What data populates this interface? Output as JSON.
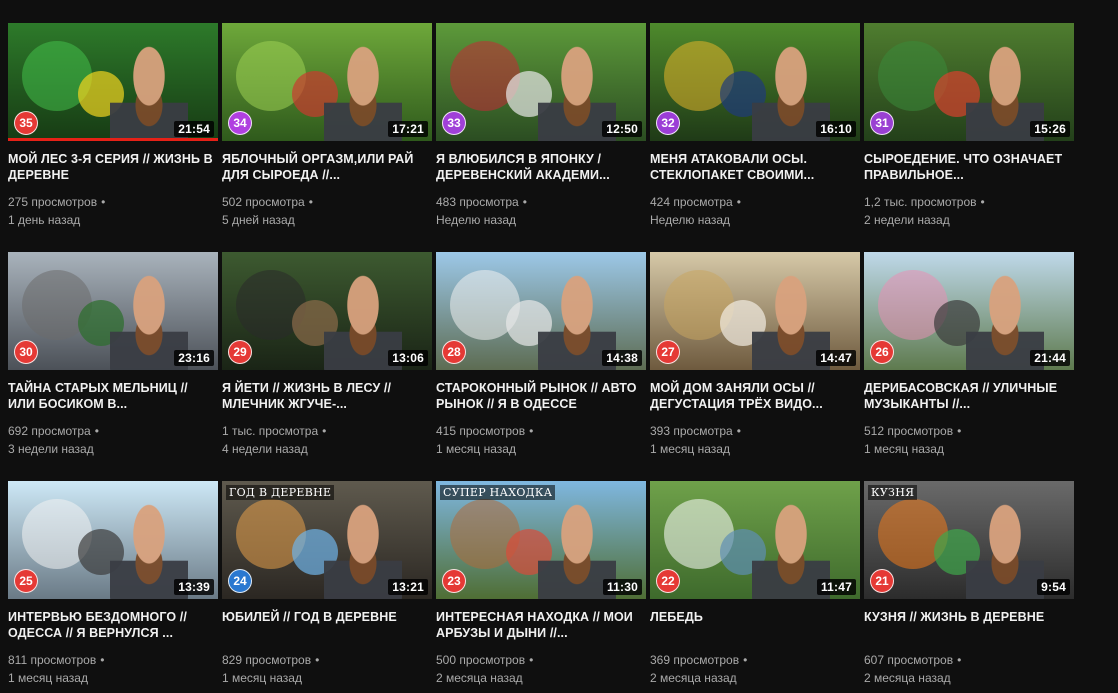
{
  "colors": {
    "background": "#0f0f0f",
    "title": "#f1f1f1",
    "meta": "#aaaaaa",
    "progress": "#e62117"
  },
  "videos": [
    {
      "title": "МОЙ ЛЕС 3-я СЕРИЯ // ЖИЗНЬ В ДЕРЕВНЕ",
      "views": "275 просмотров",
      "age": "1 день назад",
      "duration": "21:54",
      "badge": "35",
      "badge_color": "#e53935",
      "overlay": "",
      "watched": true,
      "thumb_top": "#2d7a2a",
      "thumb_bottom": "#173b14",
      "accent": "#43c04a",
      "blob": "#f2d41f"
    },
    {
      "title": "ЯБЛОЧНЫЙ ОРГАЗМ,ИЛИ РАЙ ДЛЯ СЫРОЕДА //...",
      "views": "502 просмотра",
      "age": "5 дней назад",
      "duration": "17:21",
      "badge": "34",
      "badge_color": "#b040e0",
      "overlay": "",
      "watched": false,
      "thumb_top": "#6ea83a",
      "thumb_bottom": "#2f5a1c",
      "accent": "#9fd154",
      "blob": "#c93a2f"
    },
    {
      "title": "Я ВЛЮБИЛСЯ В ЯПОНКУ / ДЕРЕВЕНСКИЙ АКАДЕМИ...",
      "views": "483 просмотра",
      "age": "Неделю назад",
      "duration": "12:50",
      "badge": "33",
      "badge_color": "#a040d8",
      "overlay": "",
      "watched": false,
      "thumb_top": "#5d9a3a",
      "thumb_bottom": "#2b4d22",
      "accent": "#c42a36",
      "blob": "#e8e8e8"
    },
    {
      "title": "МЕНЯ АТАКОВАЛИ ОСЫ. СТЕКЛОПАКЕТ СВОИМИ...",
      "views": "424 просмотра",
      "age": "Неделю назад",
      "duration": "16:10",
      "badge": "32",
      "badge_color": "#9b3ed6",
      "overlay": "",
      "watched": false,
      "thumb_top": "#4e8a2c",
      "thumb_bottom": "#1f3a17",
      "accent": "#e6b52a",
      "blob": "#1f3b7a"
    },
    {
      "title": "СЫРОЕДЕНИЕ. ЧТО ОЗНАЧАЕТ ПРАВИЛЬНОЕ...",
      "views": "1,2 тыс. просмотров",
      "age": "2 недели назад",
      "duration": "15:26",
      "badge": "31",
      "badge_color": "#9a40d2",
      "overlay": "",
      "watched": false,
      "thumb_top": "#4f7d2f",
      "thumb_bottom": "#23401a",
      "accent": "#3a8b3b",
      "blob": "#d9402e"
    },
    {
      "title": "ТАЙНА СТАРЫХ МЕЛЬНИЦ // ИЛИ БОСИКОМ В...",
      "views": "692 просмотра",
      "age": "3 недели назад",
      "duration": "23:16",
      "badge": "30",
      "badge_color": "#e53935",
      "overlay": "",
      "watched": false,
      "thumb_top": "#a9b3bc",
      "thumb_bottom": "#4c5158",
      "accent": "#6b6b6b",
      "blob": "#2b6d2b"
    },
    {
      "title": "Я ЙЕТИ // ЖИЗНЬ В ЛЕСУ // МЛЕЧНИК ЖГУЧЕ-...",
      "views": "1 тыс. просмотра",
      "age": "4 недели назад",
      "duration": "13:06",
      "badge": "29",
      "badge_color": "#e53935",
      "overlay": "",
      "watched": false,
      "thumb_top": "#3d5a30",
      "thumb_bottom": "#1a2416",
      "accent": "#2a2a2a",
      "blob": "#8c6b4a"
    },
    {
      "title": "СТАРОКОННЫЙ РЫНОК // АВТО РЫНОК // Я В ОДЕССЕ",
      "views": "415 просмотров",
      "age": "1 месяц назад",
      "duration": "14:38",
      "badge": "28",
      "badge_color": "#e53935",
      "overlay": "",
      "watched": false,
      "thumb_top": "#9cc8e8",
      "thumb_bottom": "#5d6c52",
      "accent": "#f0f0f0",
      "blob": "#e8e8e8"
    },
    {
      "title": "МОЙ ДОМ ЗАНЯЛИ ОСЫ // ДЕГУСТАЦИЯ ТРЁХ ВИДО...",
      "views": "393 просмотра",
      "age": "1 месяц назад",
      "duration": "14:47",
      "badge": "27",
      "badge_color": "#e53935",
      "overlay": "",
      "watched": false,
      "thumb_top": "#d6c9a8",
      "thumb_bottom": "#6e5a3e",
      "accent": "#c8a560",
      "blob": "#f2ede2"
    },
    {
      "title": "ДЕРИБАСОВСКАЯ // УЛИЧНЫЕ МУЗЫКАНТЫ //...",
      "views": "512 просмотров",
      "age": "1 месяц назад",
      "duration": "21:44",
      "badge": "26",
      "badge_color": "#e53935",
      "overlay": "",
      "watched": false,
      "thumb_top": "#bfd9ea",
      "thumb_bottom": "#5e7a4e",
      "accent": "#e88fb4",
      "blob": "#3a3a3a"
    },
    {
      "title": "ИНТЕРВЬЮ БЕЗДОМНОГО // ОДЕССА // Я ВЕРНУЛСЯ ...",
      "views": "811 просмотров",
      "age": "1 месяц назад",
      "duration": "13:39",
      "badge": "25",
      "badge_color": "#e53935",
      "overlay": "",
      "watched": false,
      "thumb_top": "#cde8f6",
      "thumb_bottom": "#6a7a86",
      "accent": "#f2f2f2",
      "blob": "#3c3c3c"
    },
    {
      "title": "ЮБИЛЕЙ // ГОД В ДЕРЕВНЕ",
      "views": "829 просмотров",
      "age": "1 месяц назад",
      "duration": "13:21",
      "badge": "24",
      "badge_color": "#2a78d0",
      "overlay": "ГОД В ДЕРЕВНЕ",
      "watched": false,
      "thumb_top": "#5f5a4e",
      "thumb_bottom": "#2b2722",
      "accent": "#e7a04a",
      "blob": "#6fb3e8"
    },
    {
      "title": "ИНТЕРЕСНАЯ НАХОДКА // МОИ АРБУЗЫ И ДЫНИ //...",
      "views": "500 просмотров",
      "age": "2 месяца назад",
      "duration": "11:30",
      "badge": "23",
      "badge_color": "#e53935",
      "overlay": "СУПЕР НАХОДКА",
      "watched": false,
      "thumb_top": "#7fb7e0",
      "thumb_bottom": "#4f6e34",
      "accent": "#b06a3a",
      "blob": "#d94b3a"
    },
    {
      "title": "ЛЕБЕДЬ",
      "views": "369 просмотров",
      "age": "2 месяца назад",
      "duration": "11:47",
      "badge": "22",
      "badge_color": "#e53935",
      "overlay": "",
      "watched": false,
      "thumb_top": "#6fa14a",
      "thumb_bottom": "#3e6a2c",
      "accent": "#ffffff",
      "blob": "#5e8fb3"
    },
    {
      "title": "КУЗНЯ // ЖИЗНЬ В ДЕРЕВНЕ",
      "views": "607 просмотров",
      "age": "2 месяца назад",
      "duration": "9:54",
      "badge": "21",
      "badge_color": "#e53935",
      "overlay": "КУЗНЯ",
      "watched": false,
      "thumb_top": "#6a6a6a",
      "thumb_bottom": "#2c2c2c",
      "accent": "#f07a1a",
      "blob": "#3fa64a"
    }
  ]
}
